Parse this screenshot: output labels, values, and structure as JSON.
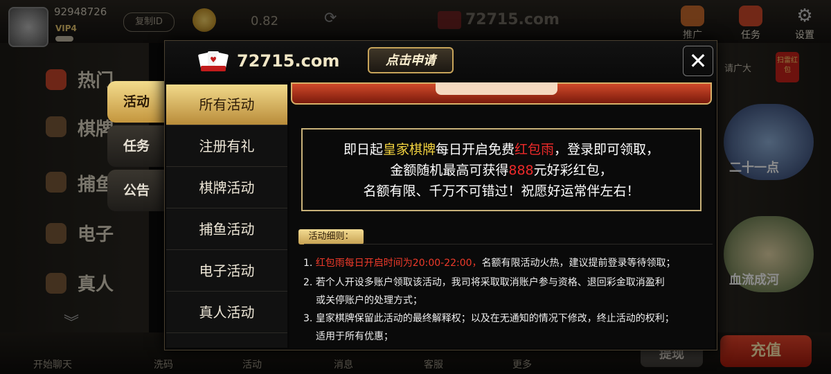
{
  "user": {
    "id": "92948726",
    "vip": "VIP4",
    "copy_id_label": "复制ID",
    "balance": "0.82"
  },
  "top_bar": {
    "site": "72715.com",
    "buttons": [
      {
        "label": "推广",
        "color": "#c96a2c"
      },
      {
        "label": "任务",
        "color": "#d04a2a"
      },
      {
        "label": "设置",
        "color": "#6a6a6a"
      }
    ]
  },
  "left_games": [
    {
      "label": "热门"
    },
    {
      "label": "棋牌"
    },
    {
      "label": "捕鱼"
    },
    {
      "label": "电子"
    },
    {
      "label": "真人"
    }
  ],
  "bottom_nav": [
    "开始聊天",
    "洗码",
    "活动",
    "消息",
    "客服",
    "更多"
  ],
  "right_panel": {
    "promo_text": "请广大",
    "red_packet": "扫雷红包",
    "game_card_1": "二十一点",
    "game_card_2": "血流成河",
    "withdraw": "提现",
    "recharge": "充值"
  },
  "modal": {
    "logo_text": "72715.com",
    "apply_button": "点击申请",
    "close_symbol": "✕",
    "side_tabs": [
      {
        "label": "活动",
        "active": true
      },
      {
        "label": "任务",
        "active": false
      },
      {
        "label": "公告",
        "active": false
      }
    ],
    "categories": [
      {
        "label": "所有活动",
        "active": true
      },
      {
        "label": "注册有礼",
        "active": false
      },
      {
        "label": "棋牌活动",
        "active": false
      },
      {
        "label": "捕鱼活动",
        "active": false
      },
      {
        "label": "电子活动",
        "active": false
      },
      {
        "label": "真人活动",
        "active": false
      }
    ],
    "notice": {
      "line1_a": "即日起",
      "line1_b": "皇家棋牌",
      "line1_c": "每日开启免费",
      "line1_d": "红包雨",
      "line1_e": "，登录即可领取，",
      "line2_a": "金额随机最高可获得",
      "line2_b": "888",
      "line2_c": "元好彩红包，",
      "line3": "名额有限、千万不可错过！祝愿好运常伴左右！"
    },
    "rules_title": "活动细则：",
    "rules": [
      {
        "num": "1.",
        "highlight": "红包雨每日开启时间为20:00-22:00，",
        "text": "名额有限活动火热，建议提前登录等待领取；"
      },
      {
        "num": "2.",
        "highlight": "",
        "text": "若个人开设多账户领取该活动，我司将采取取消账户参与资格、退回彩金取消盈利"
      },
      {
        "num": "",
        "highlight": "",
        "text": "或关停账户的处理方式；"
      },
      {
        "num": "3.",
        "highlight": "",
        "text": "皇家棋牌保留此活动的最终解释权；以及在无通知的情况下修改，终止活动的权利；"
      },
      {
        "num": "",
        "highlight": "",
        "text": "适用于所有优惠；"
      }
    ]
  },
  "colors": {
    "gold": "#e8c670",
    "accent_red": "#ef2a2a",
    "accent_yellow": "#f2d23f"
  }
}
